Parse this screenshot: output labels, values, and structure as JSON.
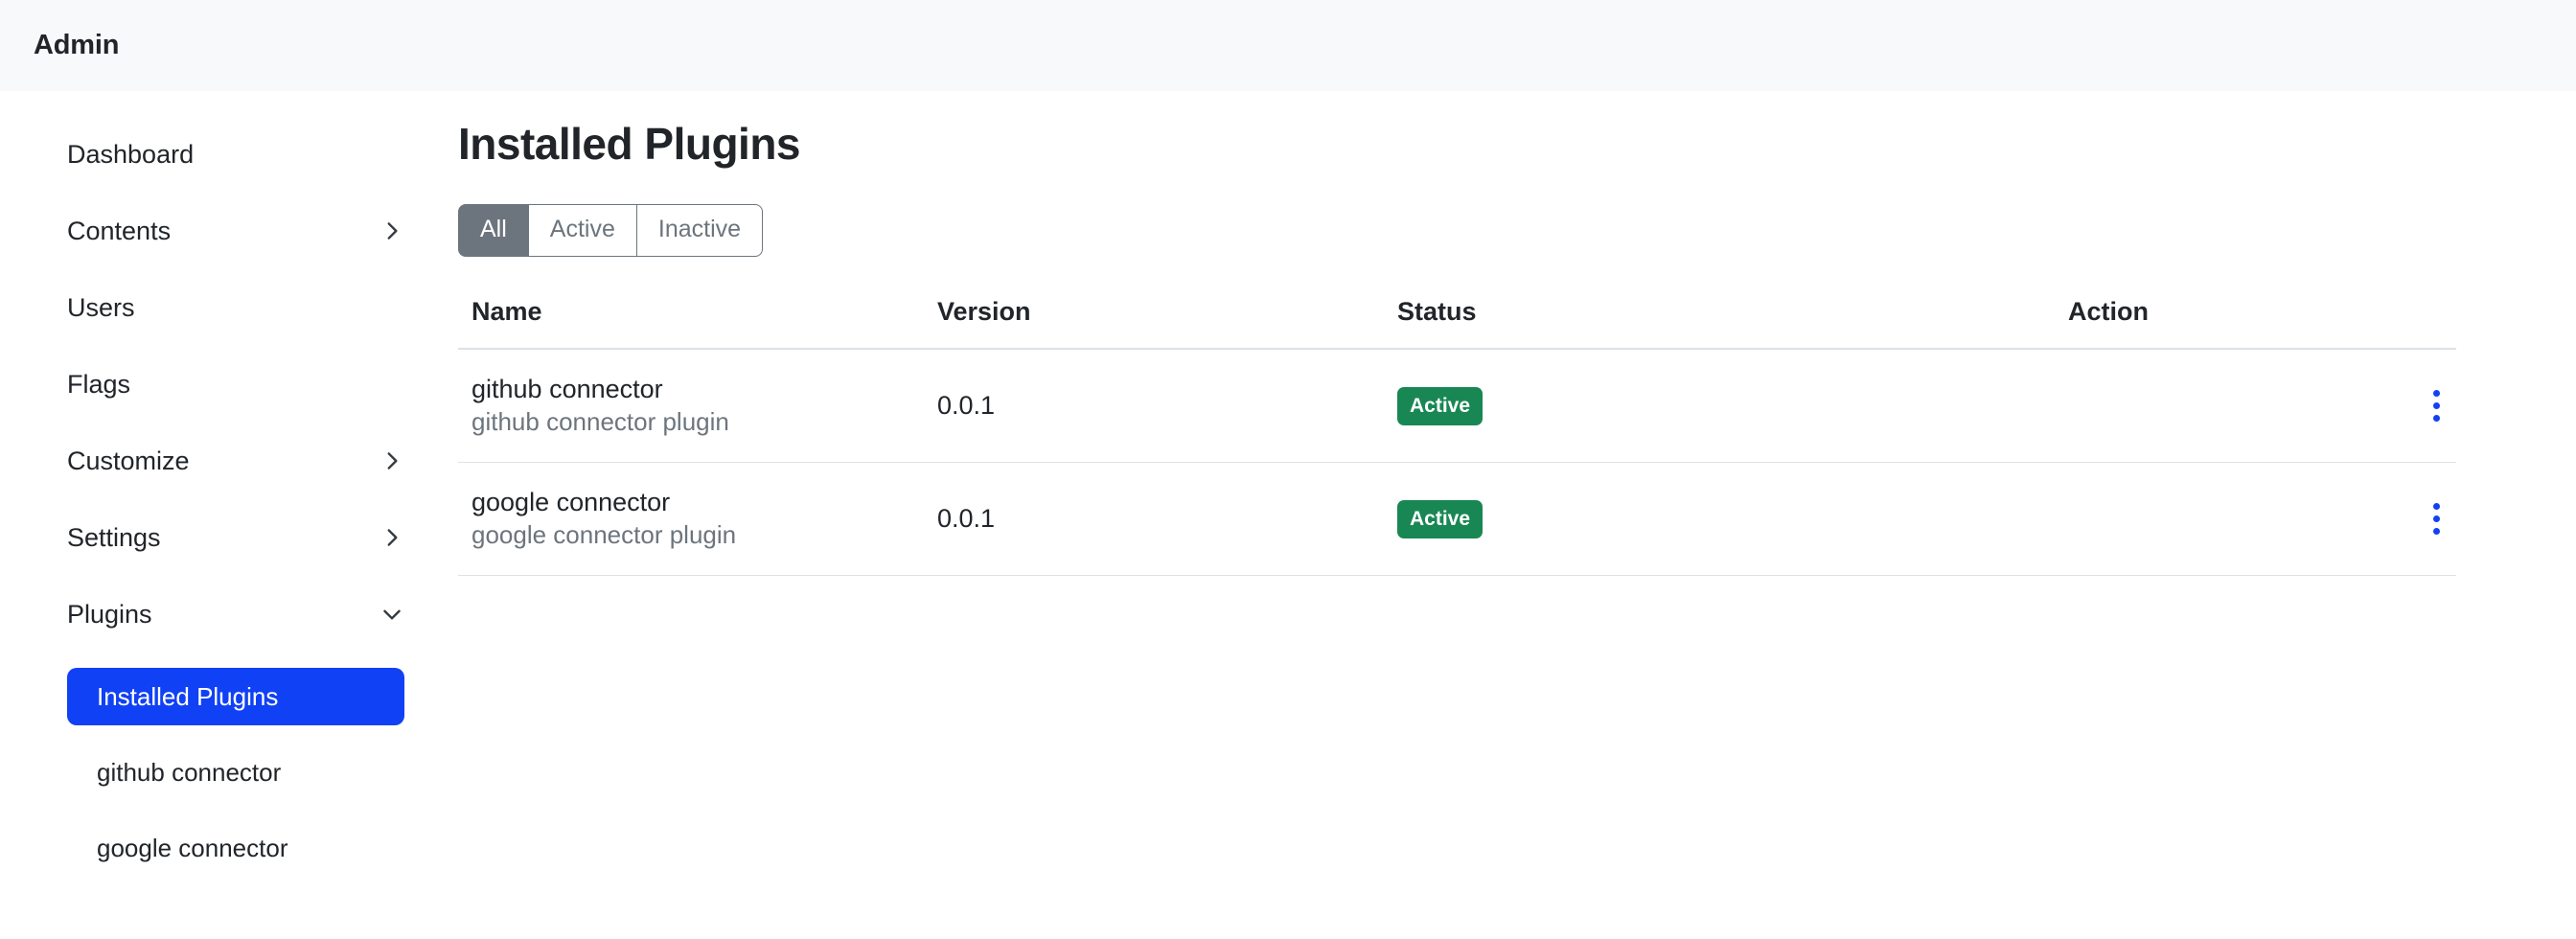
{
  "header": {
    "title": "Admin"
  },
  "sidebar": {
    "items": [
      {
        "label": "Dashboard",
        "icon": "",
        "expandable": false
      },
      {
        "label": "Contents",
        "icon": "chevron-right-icon",
        "expandable": true
      },
      {
        "label": "Users",
        "icon": "",
        "expandable": false
      },
      {
        "label": "Flags",
        "icon": "",
        "expandable": false
      },
      {
        "label": "Customize",
        "icon": "chevron-right-icon",
        "expandable": true
      },
      {
        "label": "Settings",
        "icon": "chevron-right-icon",
        "expandable": true
      },
      {
        "label": "Plugins",
        "icon": "chevron-down-icon",
        "expandable": true
      }
    ],
    "sub_items": [
      {
        "label": "Installed Plugins",
        "active": true
      },
      {
        "label": "github connector",
        "active": false
      },
      {
        "label": "google connector",
        "active": false
      }
    ]
  },
  "main": {
    "title": "Installed Plugins",
    "filters": [
      {
        "label": "All",
        "selected": true
      },
      {
        "label": "Active",
        "selected": false
      },
      {
        "label": "Inactive",
        "selected": false
      }
    ],
    "table": {
      "columns": [
        "Name",
        "Version",
        "Status",
        "Action"
      ],
      "rows": [
        {
          "name": "github connector",
          "description": "github connector plugin",
          "version": "0.0.1",
          "status": "Active",
          "action_icon": "kebab-menu-icon"
        },
        {
          "name": "google connector",
          "description": "google connector plugin",
          "version": "0.0.1",
          "status": "Active",
          "action_icon": "kebab-menu-icon"
        }
      ]
    }
  },
  "colors": {
    "accent_blue": "#1141f5",
    "status_green": "#198754",
    "muted_gray": "#6c757d",
    "header_bg": "#f8f9fa",
    "border": "#dee2e6"
  }
}
